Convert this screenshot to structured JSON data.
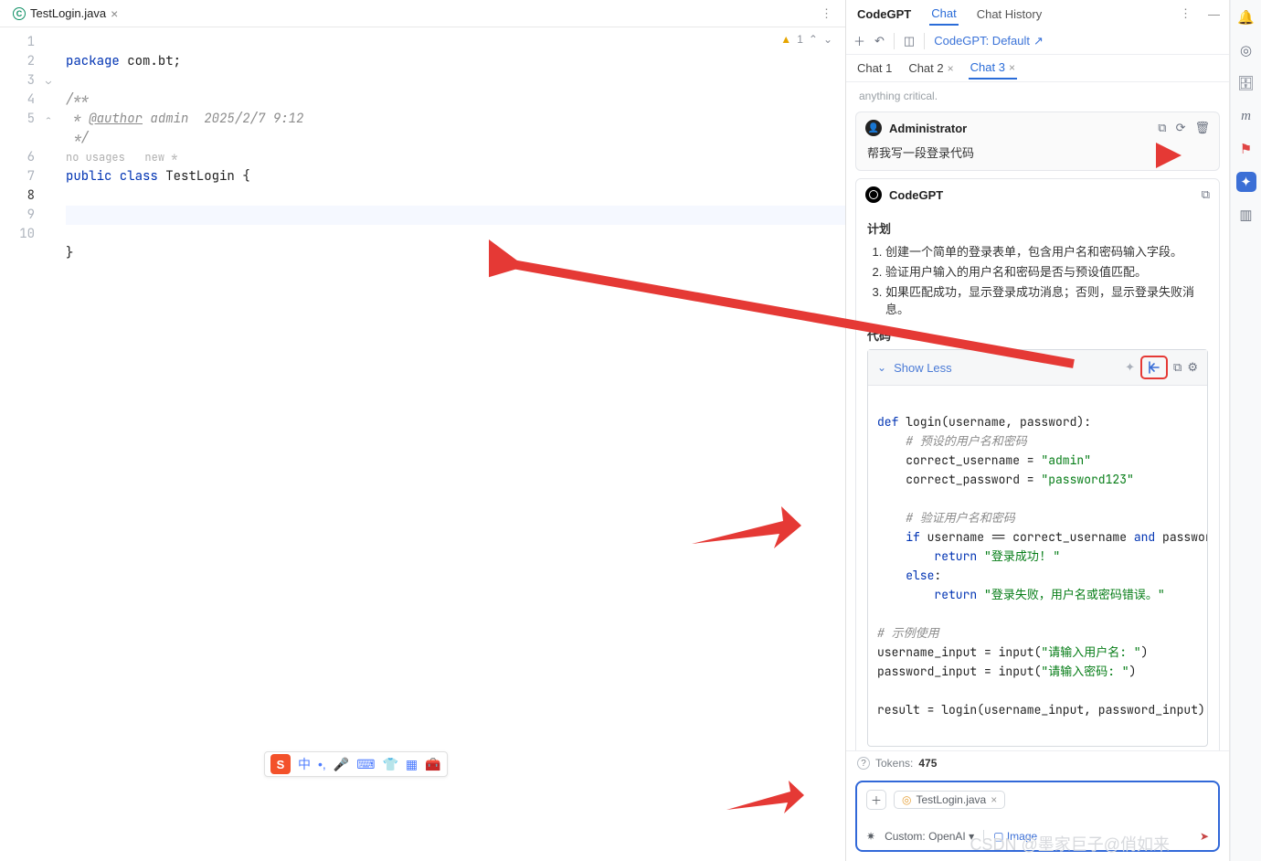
{
  "editor": {
    "file_tab": {
      "name": "TestLogin.java"
    },
    "warn_count": "1",
    "lines": {
      "l1": "package com.bt;",
      "l3": "/**",
      "l4_auth": "@author",
      "l4_rest": " admin  2025/2/7 9:12",
      "l5": " */",
      "hint_usages": "no usages",
      "hint_new": "new *",
      "l6_a": "public class ",
      "l6_b": "TestLogin",
      "l6_c": " {",
      "l9": "}"
    }
  },
  "ime": {
    "cn": "中"
  },
  "chat": {
    "top_tabs": {
      "brand": "CodeGPT",
      "chat": "Chat",
      "history": "Chat History"
    },
    "tools": {
      "service_label": "CodeGPT: Default"
    },
    "sub_tabs": {
      "t1": "Chat 1",
      "t2": "Chat 2",
      "t3": "Chat 3"
    },
    "prev_tail": "anything critical.",
    "user": {
      "name": "Administrator",
      "prompt": "帮我写一段登录代码"
    },
    "assistant": {
      "name": "CodeGPT",
      "plan_title": "计划",
      "plan": [
        "创建一个简单的登录表单，包含用户名和密码输入字段。",
        "验证用户输入的用户名和密码是否与预设值匹配。",
        "如果匹配成功，显示登录成功消息；否则，显示登录失败消息。"
      ],
      "code_title": "代码",
      "show_less": "Show Less"
    },
    "code": {
      "l1a": "def ",
      "l1b": "login",
      "l1c": "(username, password):",
      "l2": "    # 预设的用户名和密码",
      "l3a": "    correct_username = ",
      "l3b": "\"admin\"",
      "l4a": "    correct_password = ",
      "l4b": "\"password123\"",
      "l6": "    # 验证用户名和密码",
      "l7a": "    if",
      "l7b": " username == correct_username ",
      "l7c": "and",
      "l7d": " password ==",
      "l8a": "        return ",
      "l8b": "\"登录成功! \"",
      "l9a": "    else",
      "l9b": ":",
      "l10a": "        return ",
      "l10b": "\"登录失败，用户名或密码错误。\"",
      "l12": "# 示例使用",
      "l13a": "username_input = input(",
      "l13b": "\"请输入用户名: \"",
      "l13c": ")",
      "l14a": "password_input = input(",
      "l14b": "\"请输入密码: \"",
      "l14c": ")",
      "l16": "result = login(username_input, password_input)"
    },
    "tokens_label": "Tokens: ",
    "tokens_value": "475",
    "input": {
      "file_chip": "TestLogin.java",
      "model": "Custom: OpenAI",
      "image": "Image"
    }
  },
  "watermark": "CSDN @墨家巨子@俏如来"
}
